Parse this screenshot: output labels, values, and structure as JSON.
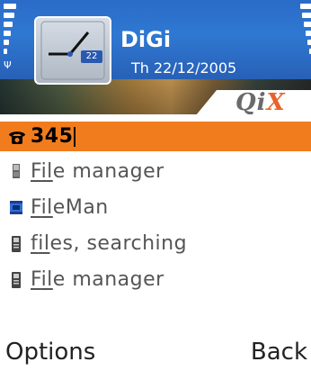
{
  "status": {
    "operator": "DiGi",
    "date": "Th 22/12/2005",
    "clock_badge": "22",
    "brand": "QiX"
  },
  "search": {
    "value": "345",
    "icon": "phone-icon"
  },
  "results": [
    {
      "prefix": "F",
      "rest_u": "il",
      "rest": "e manager",
      "icon": "memory-card-icon"
    },
    {
      "prefix": "F",
      "rest_u": "il",
      "rest": "eMan",
      "icon": "app-icon"
    },
    {
      "prefix": "f",
      "rest_u": "il",
      "rest": "es, searching",
      "icon": "note-icon"
    },
    {
      "prefix": "F",
      "rest_u": "il",
      "rest": "e manager",
      "icon": "note-icon"
    }
  ],
  "softkeys": {
    "left": "Options",
    "right": "Back"
  },
  "colors": {
    "header_blue": "#2a6cc8",
    "highlight_orange": "#f07c1e",
    "brand_x": "#e8632a"
  }
}
